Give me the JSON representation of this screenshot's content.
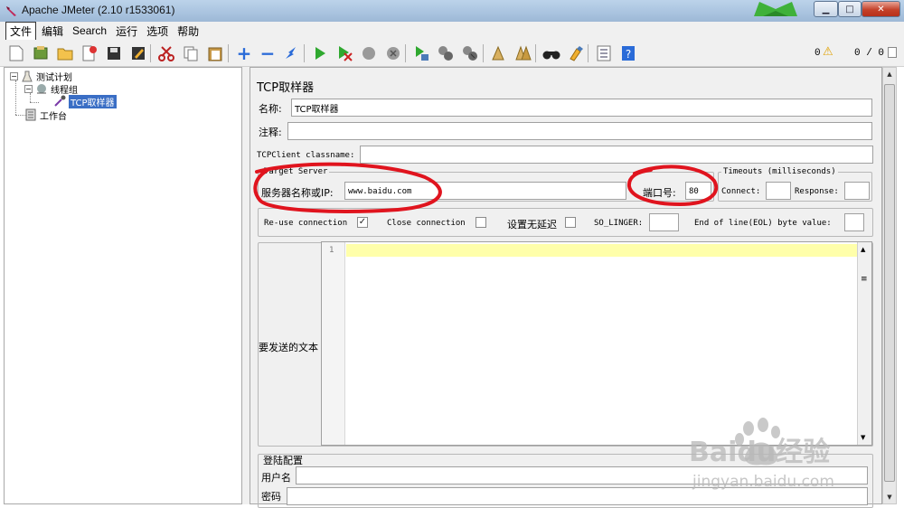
{
  "window": {
    "title": "Apache JMeter (2.10 r1533061)"
  },
  "menu": [
    "文件",
    "编辑",
    "Search",
    "运行",
    "选项",
    "帮助"
  ],
  "toolbar": {
    "warn_count": "0",
    "error_count": "0 / 0"
  },
  "tree": {
    "test_plan": "测试计划",
    "thread_group": "线程组",
    "tcp_sampler": "TCP取样器",
    "workbench": "工作台"
  },
  "panel": {
    "title": "TCP取样器",
    "name_label": "名称:",
    "name_value": "TCP取样器",
    "comment_label": "注释:",
    "classname_label": "TCPClient classname:",
    "target_server_title": "Target Server",
    "server_label": "服务器名称或IP:",
    "server_value": "www.baidu.com",
    "port_label": "端口号:",
    "port_value": "80",
    "timeouts_title": "Timeouts (milliseconds)",
    "connect_label": "Connect:",
    "response_label": "Response:",
    "reuse_label": "Re-use connection",
    "close_label": "Close connection",
    "nodelay_label": "设置无延迟",
    "solinger_label": "SO_LINGER:",
    "eol_label": "End of line(EOL) byte value:",
    "text_label": "要发送的文本",
    "line_number": "1",
    "login_title": "登陆配置",
    "username_label": "用户名",
    "password_label": "密码"
  },
  "state": {
    "reuse_checked": true,
    "close_checked": false,
    "nodelay_checked": false
  },
  "watermark": {
    "brand": "Baidu经验",
    "url": "jingyan.baidu.com"
  }
}
